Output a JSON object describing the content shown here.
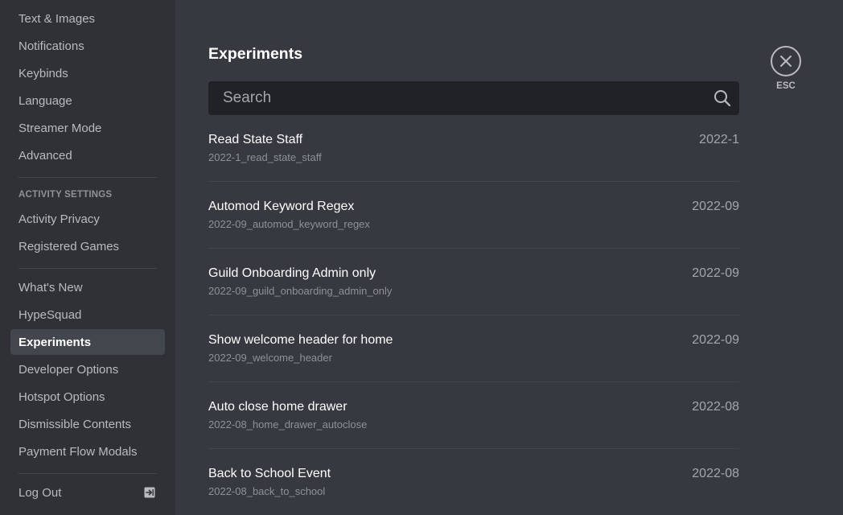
{
  "sidebar": {
    "items_top": [
      {
        "label": "Text & Images"
      },
      {
        "label": "Notifications"
      },
      {
        "label": "Keybinds"
      },
      {
        "label": "Language"
      },
      {
        "label": "Streamer Mode"
      },
      {
        "label": "Advanced"
      }
    ],
    "activity_header": "ACTIVITY SETTINGS",
    "activity_items": [
      {
        "label": "Activity Privacy"
      },
      {
        "label": "Registered Games"
      }
    ],
    "misc_items": [
      {
        "label": "What's New"
      },
      {
        "label": "HypeSquad"
      },
      {
        "label": "Experiments",
        "selected": true
      },
      {
        "label": "Developer Options"
      },
      {
        "label": "Hotspot Options"
      },
      {
        "label": "Dismissible Contents"
      },
      {
        "label": "Payment Flow Modals"
      }
    ],
    "logout_label": "Log Out",
    "logout_icon": "logout-icon"
  },
  "main": {
    "title": "Experiments",
    "search": {
      "placeholder": "Search",
      "value": "",
      "icon": "search-icon"
    },
    "experiments": [
      {
        "name": "Read State Staff",
        "id": "2022-1_read_state_staff",
        "bucket": "2022-1"
      },
      {
        "name": "Automod Keyword Regex",
        "id": "2022-09_automod_keyword_regex",
        "bucket": "2022-09"
      },
      {
        "name": "Guild Onboarding Admin only",
        "id": "2022-09_guild_onboarding_admin_only",
        "bucket": "2022-09"
      },
      {
        "name": "Show welcome header for home",
        "id": "2022-09_welcome_header",
        "bucket": "2022-09"
      },
      {
        "name": "Auto close home drawer",
        "id": "2022-08_home_drawer_autoclose",
        "bucket": "2022-08"
      },
      {
        "name": "Back to School Event",
        "id": "2022-08_back_to_school",
        "bucket": "2022-08"
      }
    ]
  },
  "close": {
    "label": "ESC",
    "icon": "close-icon"
  },
  "colors": {
    "sidebar_bg": "#2f3136",
    "content_bg": "#36393f",
    "selected_bg": "#42464d",
    "search_bg": "#202225",
    "text_primary": "#ffffff",
    "text_muted": "#b9bbbe"
  }
}
